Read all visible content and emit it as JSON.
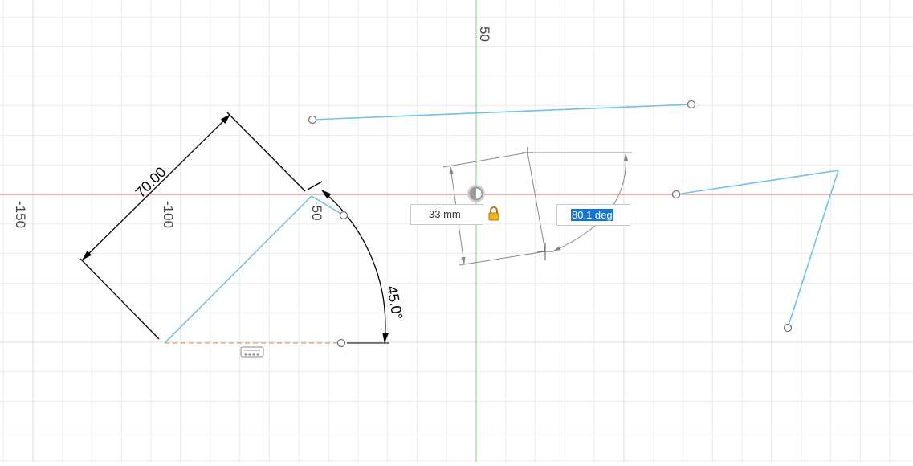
{
  "axis_labels": {
    "y_axis_top": "50",
    "x_neg150": "-150",
    "x_neg100": "-100",
    "x_neg50": "-50"
  },
  "dimensions": {
    "length": "70.00",
    "angle": "45.0°"
  },
  "inputs": {
    "distance_value": "33 mm",
    "angle_value": "80.1 deg"
  },
  "icons": {
    "lock": "lock-icon",
    "constraint": "horizontal-constraint-icon",
    "snap": "snap-point-icon"
  },
  "colors": {
    "sketch_line": "#6ec3e8",
    "x_axis": "#e05a5a",
    "y_axis": "#7fd67f",
    "construction": "#e8a070",
    "dimension": "#000000",
    "grid": "#e6e6e6",
    "selection": "#1573d2"
  }
}
